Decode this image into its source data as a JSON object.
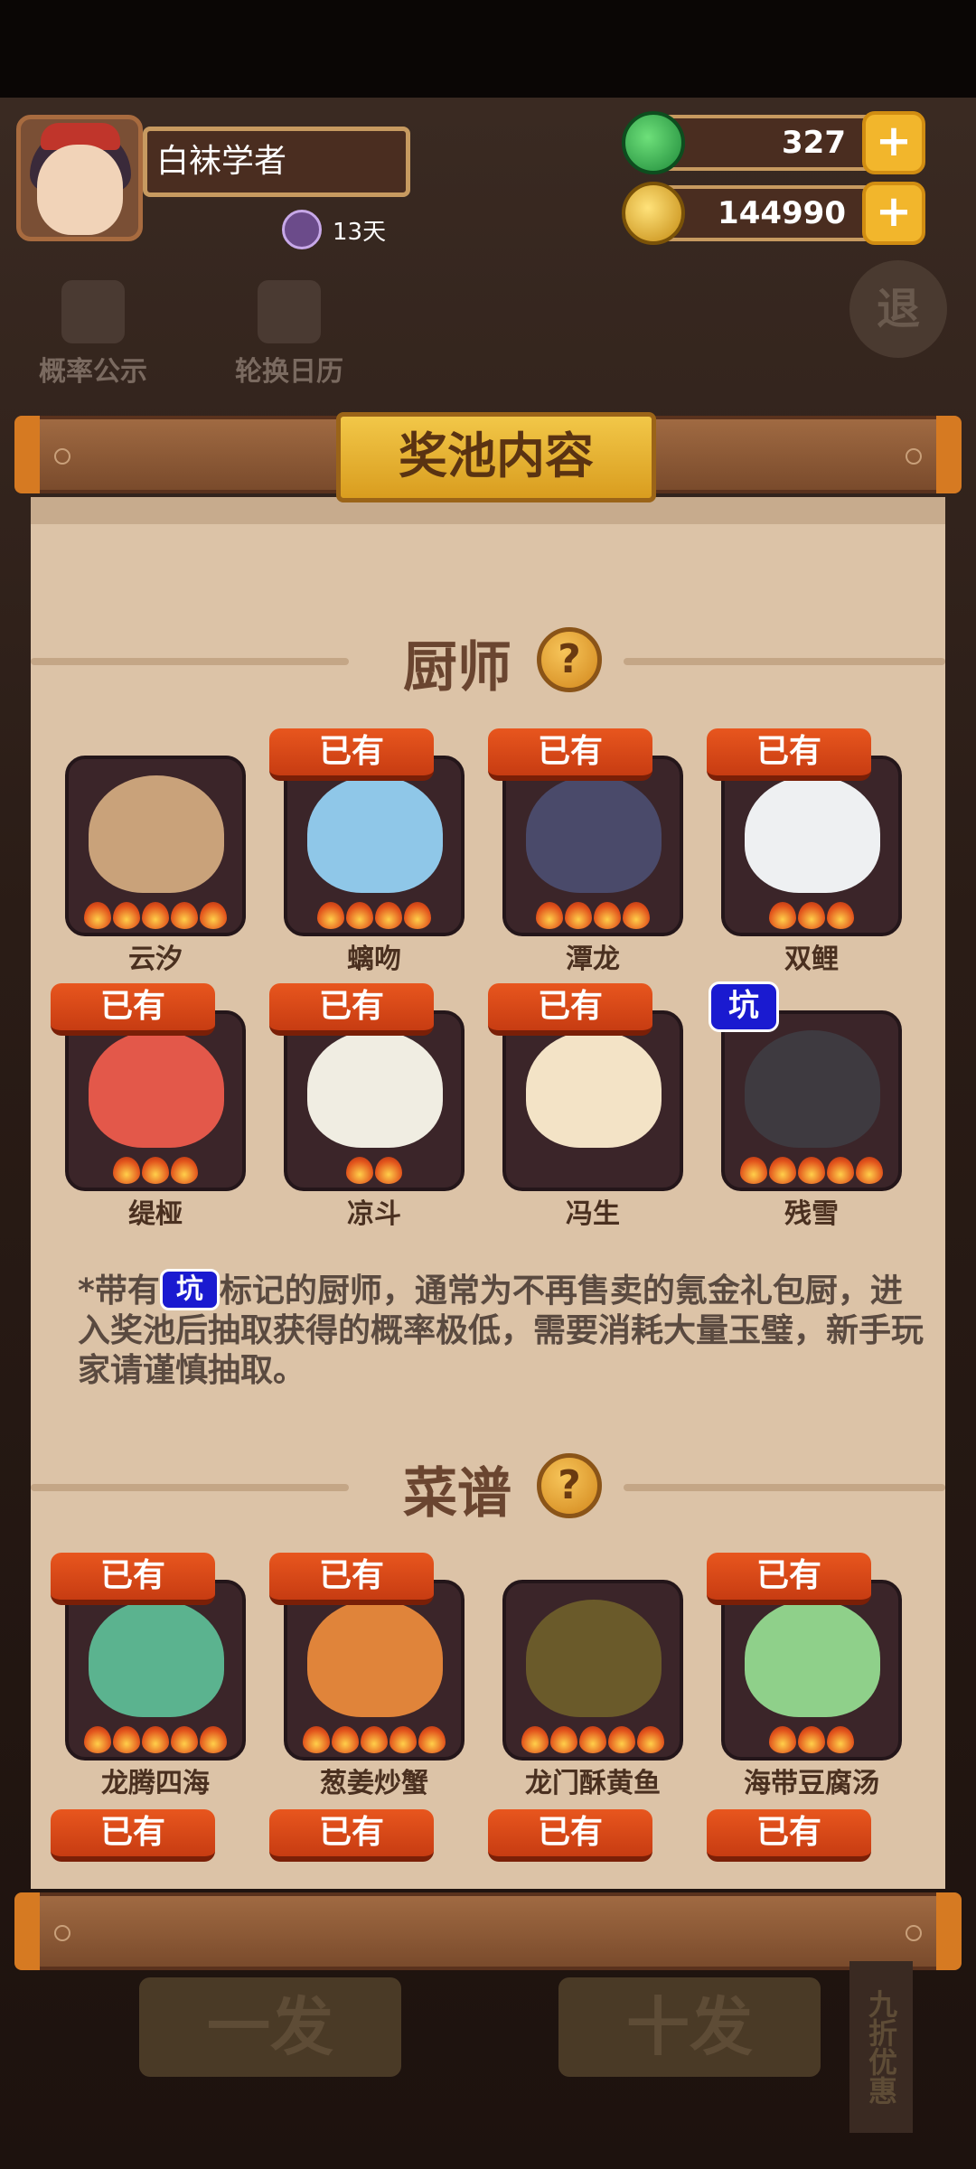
{
  "player": {
    "name": "白袜学者",
    "streak": "13天"
  },
  "currency": {
    "jade": "327",
    "gold": "144990",
    "plus": "+"
  },
  "menu": {
    "probability": "概率公示",
    "calendar": "轮换日历",
    "exit": "退"
  },
  "modal": {
    "title": "奖池内容"
  },
  "sections": {
    "chefs": "厨师",
    "recipes": "菜谱",
    "help": "?"
  },
  "badges": {
    "owned": "已有",
    "pit": "坑"
  },
  "chefs": [
    {
      "name": "云汐",
      "owned": false,
      "pit": false,
      "stars": 5,
      "color": "#c9a27a"
    },
    {
      "name": "螭吻",
      "owned": true,
      "pit": false,
      "stars": 4,
      "color": "#8fc7e8"
    },
    {
      "name": "潭龙",
      "owned": true,
      "pit": false,
      "stars": 4,
      "color": "#4a4a6a"
    },
    {
      "name": "双鲤",
      "owned": true,
      "pit": false,
      "stars": 3,
      "color": "#eef0f2"
    },
    {
      "name": "缇桠",
      "owned": true,
      "pit": false,
      "stars": 3,
      "color": "#e3584a"
    },
    {
      "name": "凉斗",
      "owned": true,
      "pit": false,
      "stars": 2,
      "color": "#f0ede2"
    },
    {
      "name": "冯生",
      "owned": true,
      "pit": false,
      "stars": 0,
      "color": "#f3e3c6"
    },
    {
      "name": "残雪",
      "owned": false,
      "pit": true,
      "stars": 5,
      "color": "#3e3a40"
    }
  ],
  "note": {
    "prefix": "*带有",
    "body": "标记的厨师，通常为不再售卖的氪金礼包厨，进入奖池后抽取获得的概率极低，需要消耗大量玉璧，新手玩家请谨慎抽取。"
  },
  "recipes": [
    {
      "name": "龙腾四海",
      "owned": true,
      "stars": 5,
      "color": "#5bb38f"
    },
    {
      "name": "葱姜炒蟹",
      "owned": true,
      "stars": 5,
      "color": "#e0843a"
    },
    {
      "name": "龙门酥黄鱼",
      "owned": false,
      "stars": 5,
      "color": "#6a5a2a"
    },
    {
      "name": "海带豆腐汤",
      "owned": true,
      "stars": 3,
      "color": "#8fd08a"
    }
  ],
  "next_row_badges": [
    "已有",
    "已有",
    "已有",
    "已有"
  ],
  "bottom": {
    "single": "一发",
    "ten": "十发",
    "discount": "九折优惠"
  }
}
